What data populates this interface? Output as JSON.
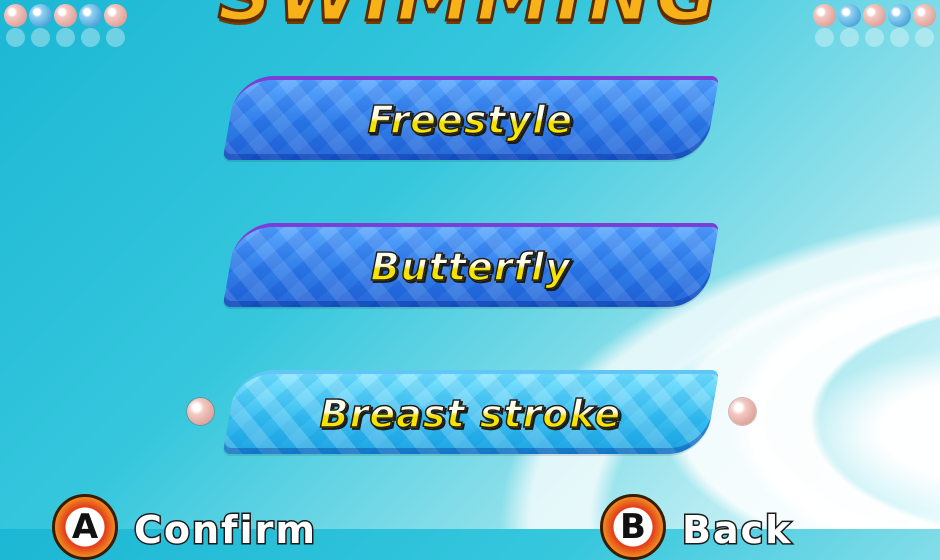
{
  "header": {
    "title": "SWIMMING"
  },
  "menu": {
    "items": [
      {
        "label": "Freestyle"
      },
      {
        "label": "Butterfly"
      },
      {
        "label": "Breast stroke"
      }
    ],
    "selected_index": 2
  },
  "controls": {
    "confirm": {
      "button": "A",
      "label": "Confirm"
    },
    "back": {
      "button": "B",
      "label": "Back"
    }
  },
  "icons": {
    "decorative_balls": "bead-icon",
    "cursor": "selection-bead-icon"
  },
  "colors": {
    "menu_item": "#2f7de8",
    "menu_item_selected": "#3bbef0",
    "label_text": "#fff9a0",
    "title": "#f7b21a"
  }
}
